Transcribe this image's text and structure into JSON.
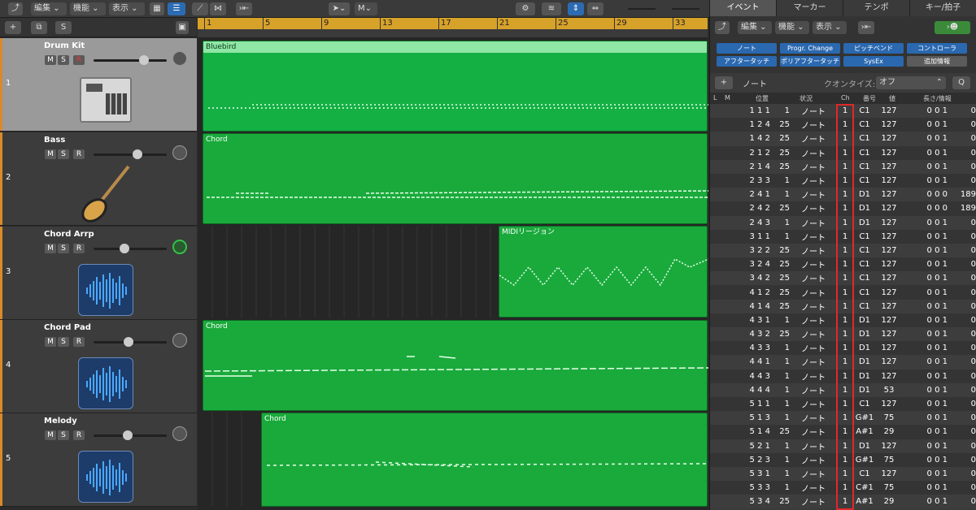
{
  "toolbar": {
    "edit": "編集",
    "func": "機能",
    "view": "表示",
    "tool": "M"
  },
  "ruler": [
    "1",
    "5",
    "9",
    "13",
    "17",
    "21",
    "25",
    "29",
    "33"
  ],
  "tracks": [
    {
      "num": "1",
      "name": "Drum Kit",
      "m": "M",
      "s": "S",
      "r": "R"
    },
    {
      "num": "2",
      "name": "Bass",
      "m": "M",
      "s": "S",
      "r": "R"
    },
    {
      "num": "3",
      "name": "Chord Arrp",
      "m": "M",
      "s": "S",
      "r": "R"
    },
    {
      "num": "4",
      "name": "Chord Pad",
      "m": "M",
      "s": "S",
      "r": "R"
    },
    {
      "num": "5",
      "name": "Melody",
      "m": "M",
      "s": "S",
      "r": "R"
    }
  ],
  "regions": [
    "Bluebird",
    "Chord",
    "MIDIリージョン",
    "Chord",
    "Chord"
  ],
  "right": {
    "tabs": [
      "イベント",
      "マーカー",
      "テンポ",
      "キー/拍子"
    ],
    "edit": "編集",
    "func": "機能",
    "view": "表示",
    "filters": [
      "ノート",
      "Progr. Change",
      "ピッチベンド",
      "コントローラ",
      "アフタータッチ",
      "ポリアフタータッチ",
      "SysEx",
      "追加情報"
    ],
    "add_label": "ノート",
    "quant_label": "クオンタイズ:",
    "quant_value": "オフ",
    "q": "Q",
    "cols": [
      "L",
      "M",
      "位置",
      "状況",
      "Ch",
      "番号",
      "値",
      "長さ/情報"
    ],
    "rows": [
      [
        "1 1 1",
        "1",
        "ノート",
        "1",
        "C1",
        "127",
        "0 0 1",
        "0"
      ],
      [
        "1 2 4",
        "25",
        "ノート",
        "1",
        "C1",
        "127",
        "0 0 1",
        "0"
      ],
      [
        "1 4 2",
        "25",
        "ノート",
        "1",
        "C1",
        "127",
        "0 0 1",
        "0"
      ],
      [
        "2 1 2",
        "25",
        "ノート",
        "1",
        "C1",
        "127",
        "0 0 1",
        "0"
      ],
      [
        "2 1 4",
        "25",
        "ノート",
        "1",
        "C1",
        "127",
        "0 0 1",
        "0"
      ],
      [
        "2 3 3",
        "1",
        "ノート",
        "1",
        "C1",
        "127",
        "0 0 1",
        "0"
      ],
      [
        "2 4 1",
        "1",
        "ノート",
        "1",
        "D1",
        "127",
        "0 0 0",
        "189"
      ],
      [
        "2 4 2",
        "25",
        "ノート",
        "1",
        "D1",
        "127",
        "0 0 0",
        "189"
      ],
      [
        "2 4 3",
        "1",
        "ノート",
        "1",
        "D1",
        "127",
        "0 0 1",
        "0"
      ],
      [
        "3 1 1",
        "1",
        "ノート",
        "1",
        "C1",
        "127",
        "0 0 1",
        "0"
      ],
      [
        "3 2 2",
        "25",
        "ノート",
        "1",
        "C1",
        "127",
        "0 0 1",
        "0"
      ],
      [
        "3 2 4",
        "25",
        "ノート",
        "1",
        "C1",
        "127",
        "0 0 1",
        "0"
      ],
      [
        "3 4 2",
        "25",
        "ノート",
        "1",
        "C1",
        "127",
        "0 0 1",
        "0"
      ],
      [
        "4 1 2",
        "25",
        "ノート",
        "1",
        "C1",
        "127",
        "0 0 1",
        "0"
      ],
      [
        "4 1 4",
        "25",
        "ノート",
        "1",
        "C1",
        "127",
        "0 0 1",
        "0"
      ],
      [
        "4 3 1",
        "1",
        "ノート",
        "1",
        "D1",
        "127",
        "0 0 1",
        "0"
      ],
      [
        "4 3 2",
        "25",
        "ノート",
        "1",
        "D1",
        "127",
        "0 0 1",
        "0"
      ],
      [
        "4 3 3",
        "1",
        "ノート",
        "1",
        "D1",
        "127",
        "0 0 1",
        "0"
      ],
      [
        "4 4 1",
        "1",
        "ノート",
        "1",
        "D1",
        "127",
        "0 0 1",
        "0"
      ],
      [
        "4 4 3",
        "1",
        "ノート",
        "1",
        "D1",
        "127",
        "0 0 1",
        "0"
      ],
      [
        "4 4 4",
        "1",
        "ノート",
        "1",
        "D1",
        "53",
        "0 0 1",
        "0"
      ],
      [
        "5 1 1",
        "1",
        "ノート",
        "1",
        "C1",
        "127",
        "0 0 1",
        "0"
      ],
      [
        "5 1 3",
        "1",
        "ノート",
        "1",
        "G#1",
        "75",
        "0 0 1",
        "0"
      ],
      [
        "5 1 4",
        "25",
        "ノート",
        "1",
        "A#1",
        "29",
        "0 0 1",
        "0"
      ],
      [
        "5 2 1",
        "1",
        "ノート",
        "1",
        "D1",
        "127",
        "0 0 1",
        "0"
      ],
      [
        "5 2 3",
        "1",
        "ノート",
        "1",
        "G#1",
        "75",
        "0 0 1",
        "0"
      ],
      [
        "5 3 1",
        "1",
        "ノート",
        "1",
        "C1",
        "127",
        "0 0 1",
        "0"
      ],
      [
        "5 3 3",
        "1",
        "ノート",
        "1",
        "C#1",
        "75",
        "0 0 1",
        "0"
      ],
      [
        "5 3 4",
        "25",
        "ノート",
        "1",
        "A#1",
        "29",
        "0 0 1",
        "0"
      ]
    ]
  }
}
